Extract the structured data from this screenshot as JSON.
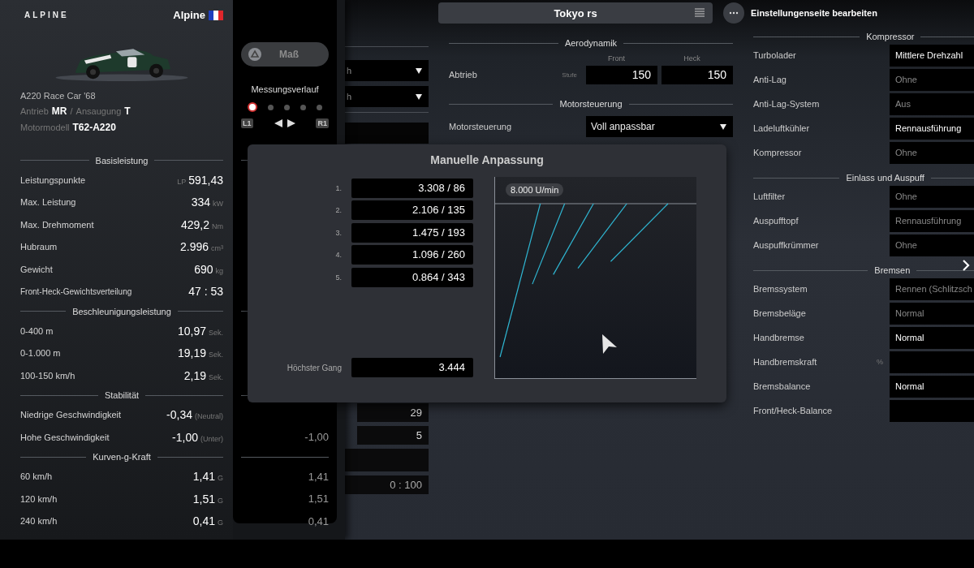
{
  "car": {
    "brand_logo": "ALPINE",
    "maker": "Alpine",
    "name": "A220 Race Car '68",
    "drive_label": "Antrieb",
    "drive": "MR",
    "separator": "/",
    "aspiration_label": "Ansaugung",
    "aspiration": "T",
    "engine_label": "Motormodell",
    "engine": "T62-A220"
  },
  "measure": {
    "button": "Maß",
    "history_title": "Messungsverlauf",
    "history": [
      {
        "selected": true
      },
      {
        "selected": false
      },
      {
        "selected": false
      },
      {
        "selected": false
      },
      {
        "selected": false
      }
    ],
    "left_key": "L1",
    "right_key": "R1"
  },
  "stat_sections": [
    {
      "title": "Basisleistung",
      "rows": [
        {
          "label": "Leistungspunkte",
          "prefix": "LP",
          "value": "591,43"
        },
        {
          "label": "Max. Leistung",
          "value": "334",
          "unit": "kW"
        },
        {
          "label": "Max. Drehmoment",
          "value": "429,2",
          "unit": "Nm"
        },
        {
          "label": "Hubraum",
          "value": "2.996",
          "unit": "cm³"
        },
        {
          "label": "Gewicht",
          "value": "690",
          "unit": "kg"
        },
        {
          "label": "Front-Heck-Gewichtsverteilung",
          "value": "47 : 53"
        }
      ]
    },
    {
      "title": "Beschleunigungsleistung",
      "rows": [
        {
          "label": "0-400 m",
          "value": "10,97",
          "unit": "Sek."
        },
        {
          "label": "0-1.000 m",
          "value": "19,19",
          "unit": "Sek."
        },
        {
          "label": "100-150 km/h",
          "value": "2,19",
          "unit": "Sek."
        }
      ]
    },
    {
      "title": "Stabilität",
      "rows": [
        {
          "label": "Niedrige Geschwindigkeit",
          "value": "-0,34",
          "unit": "(Neutral)"
        },
        {
          "label": "Hohe Geschwindigkeit",
          "value": "-1,00",
          "unit": "(Unter)",
          "compare": "-1,00"
        }
      ]
    },
    {
      "title": "Kurven-g-Kraft",
      "rows": [
        {
          "label": "60 km/h",
          "value": "1,41",
          "unit": "G",
          "compare": "1,41"
        },
        {
          "label": "120 km/h",
          "value": "1,51",
          "unit": "G",
          "compare": "1,51"
        },
        {
          "label": "240 km/h",
          "value": "0,41",
          "unit": "G",
          "compare": "0,41"
        }
      ]
    }
  ],
  "header": {
    "setup_name": "Tokyo rs",
    "edit_label": "Einstellungenseite bearbeiten"
  },
  "hidden_column": {
    "top_dropdowns": [
      "h",
      "h"
    ],
    "bottom_values": [
      {
        "kind": "value",
        "value": "29"
      },
      {
        "kind": "value",
        "value": "5"
      },
      {
        "kind": "blank"
      },
      {
        "kind": "value",
        "value": "0 : 100"
      }
    ]
  },
  "aero": {
    "title": "Aerodynamik",
    "front_label": "Front",
    "rear_label": "Heck",
    "label": "Abtrieb",
    "unit": "Stufe",
    "front": "150",
    "rear": "150"
  },
  "ecu": {
    "title": "Motorsteuerung",
    "label": "Motorsteuerung",
    "value": "Voll anpassbar"
  },
  "right_sections": [
    {
      "title": "Kompressor",
      "rows": [
        {
          "label": "Turbolader",
          "value": "Mittlere Drehzahl",
          "disabled": false
        },
        {
          "label": "Anti-Lag",
          "value": "Ohne",
          "disabled": true
        },
        {
          "label": "Anti-Lag-System",
          "value": "Aus",
          "disabled": true
        },
        {
          "label": "Ladeluftkühler",
          "value": "Rennausführung",
          "disabled": false
        },
        {
          "label": "Kompressor",
          "value": "Ohne",
          "disabled": true
        }
      ]
    },
    {
      "title": "Einlass und Auspuff",
      "rows": [
        {
          "label": "Luftfilter",
          "value": "Ohne",
          "disabled": true
        },
        {
          "label": "Auspufftopf",
          "value": "Rennausführung",
          "disabled": true
        },
        {
          "label": "Auspuffkrümmer",
          "value": "Ohne",
          "disabled": true
        }
      ]
    },
    {
      "title": "Bremsen",
      "rows": [
        {
          "label": "Bremssystem",
          "value": "Rennen (Schlitzsch",
          "disabled": true
        },
        {
          "label": "Bremsbeläge",
          "value": "Normal",
          "disabled": true
        },
        {
          "label": "Handbremse",
          "value": "Normal",
          "disabled": false
        },
        {
          "label": "Handbremskraft",
          "unit": "%"
        },
        {
          "label": "Bremsbalance",
          "value": "Normal",
          "disabled": false
        },
        {
          "label": "Front/Heck-Balance"
        }
      ]
    }
  ],
  "dialog": {
    "title": "Manuelle Anpassung",
    "gears": [
      {
        "label": "1.",
        "value": "3.308 / 86"
      },
      {
        "label": "2.",
        "value": "2.106 / 135"
      },
      {
        "label": "3.",
        "value": "1.475 / 193"
      },
      {
        "label": "4.",
        "value": "1.096 / 260"
      },
      {
        "label": "5.",
        "value": "0.864 / 343"
      }
    ],
    "top_gear_label": "Höchster Gang",
    "top_gear": "3.444",
    "rpm_label": "8.000 U/min"
  }
}
